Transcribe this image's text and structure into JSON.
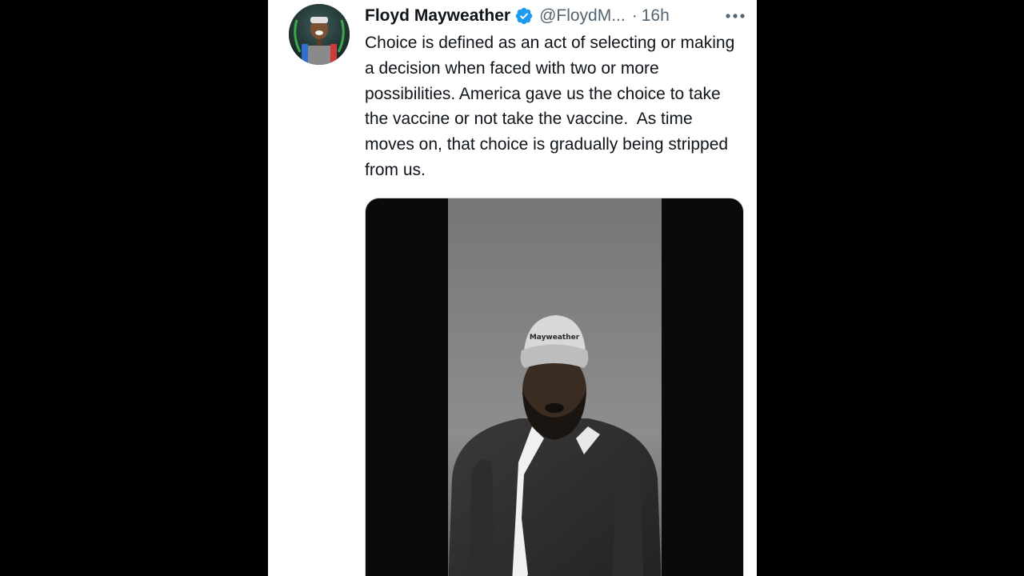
{
  "tweet": {
    "author_name": "Floyd Mayweather",
    "handle": "@FloydM...",
    "separator": "·",
    "timestamp": "16h",
    "text": "Choice is defined as an act of selecting or making a decision when faced with two or more possibilities. America gave us the choice to take the vaccine or not take the vaccine.  As time moves on, that choice is gradually being stripped from us.",
    "icons": {
      "verified": "verified-badge-icon",
      "more": "more-options-icon"
    },
    "colors": {
      "text": "#0f1419",
      "secondary": "#536471",
      "verified": "#1d9bf0",
      "background": "#ffffff"
    }
  },
  "media": {
    "type": "video-thumbnail",
    "cap_text": "Mayweather"
  }
}
